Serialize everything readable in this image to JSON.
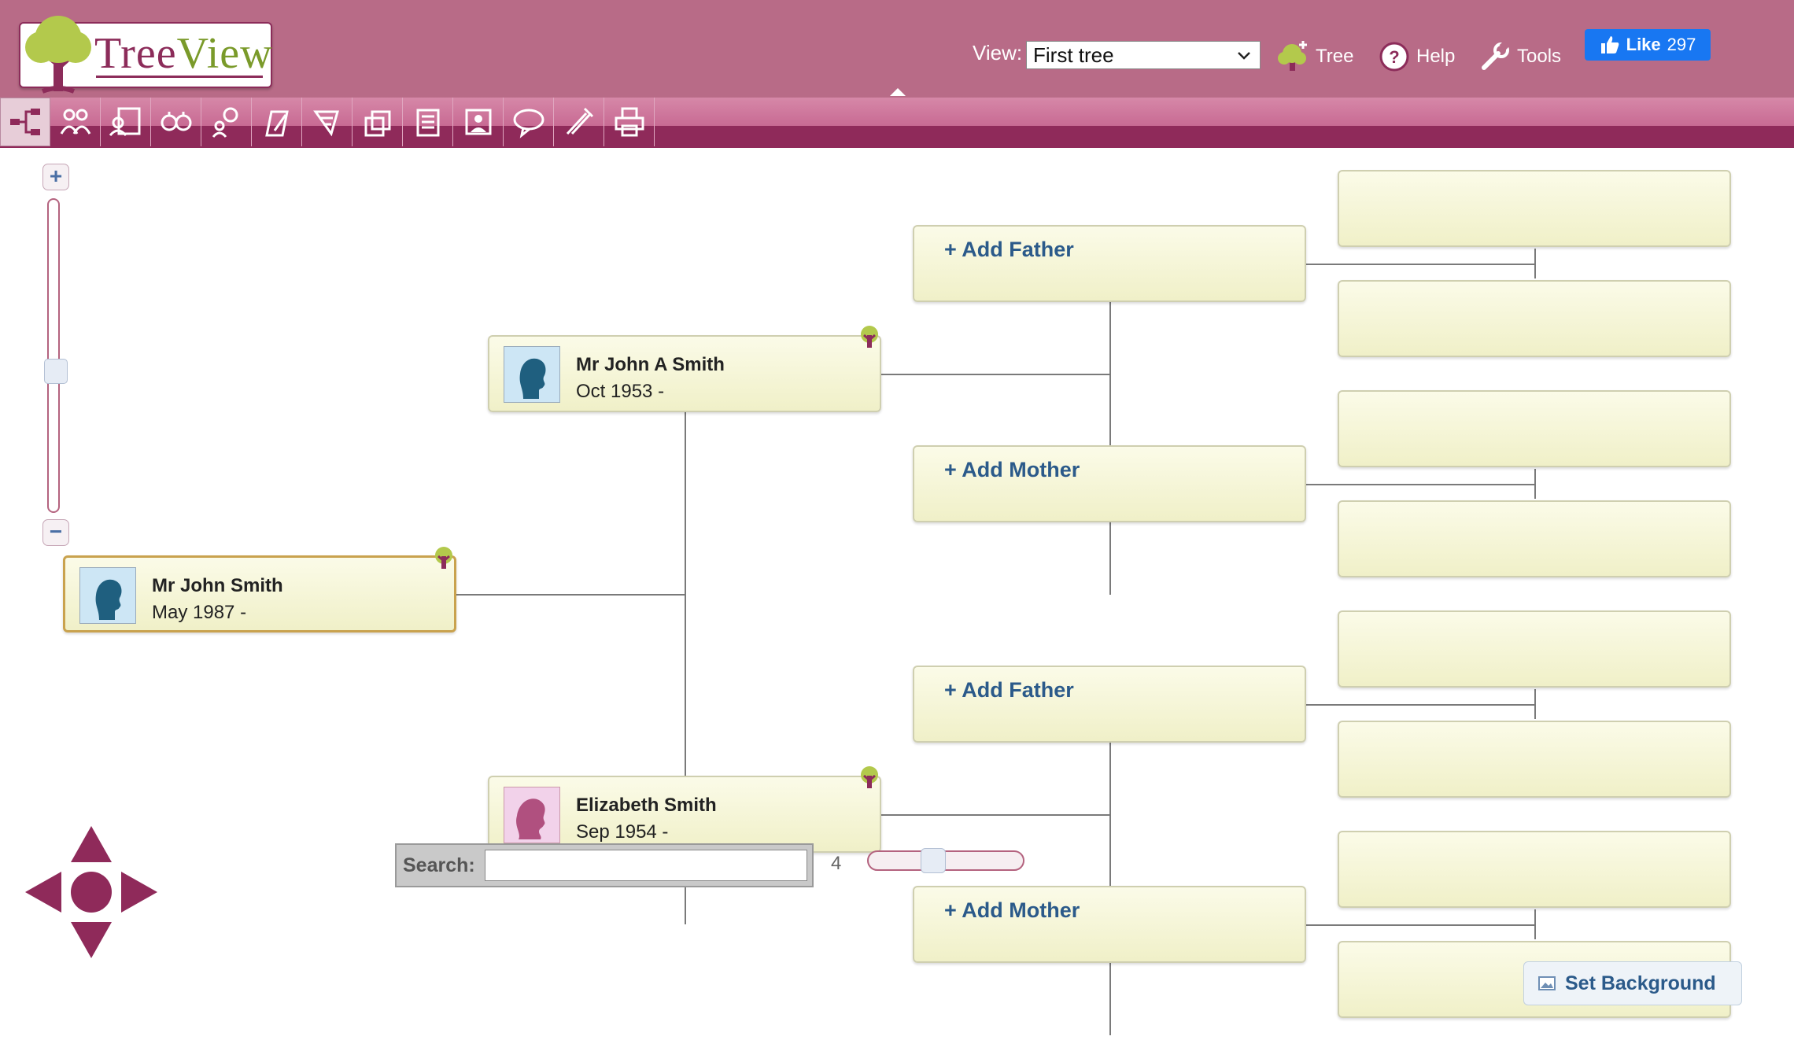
{
  "header": {
    "logo_text_a": "Tree",
    "logo_text_b": "View",
    "view_label": "View:",
    "view_selected": "First tree",
    "links": {
      "tree": "Tree",
      "help": "Help",
      "tools": "Tools"
    },
    "like_label": "Like",
    "like_count": "297"
  },
  "toolbar": {
    "buttons": [
      {
        "icon": "tree-chart-icon"
      },
      {
        "icon": "family-icon"
      },
      {
        "icon": "person-list-icon"
      },
      {
        "icon": "places-icon"
      },
      {
        "icon": "search-person-icon"
      },
      {
        "icon": "edit-icon"
      },
      {
        "icon": "sources-icon"
      },
      {
        "icon": "files-icon"
      },
      {
        "icon": "notes-icon"
      },
      {
        "icon": "profile-icon"
      },
      {
        "icon": "message-icon"
      },
      {
        "icon": "tools-icon"
      },
      {
        "icon": "print-icon"
      }
    ]
  },
  "people": {
    "root": {
      "name": "Mr John Smith",
      "date": "May 1987 -"
    },
    "father": {
      "name": "Mr John A Smith",
      "date": "Oct 1953 -"
    },
    "mother": {
      "name": "Elizabeth Smith",
      "date": "Sep 1954 -"
    }
  },
  "add": {
    "father_1": "+ Add Father",
    "mother_1": "+ Add Mother",
    "father_2": "+ Add Father",
    "mother_2": "+ Add Mother"
  },
  "controls": {
    "zoom_plus": "+",
    "zoom_minus": "−",
    "search_label": "Search:",
    "search_value": "",
    "generations": "4",
    "set_background": "Set Background"
  },
  "colors": {
    "header_bg": "#b86b87",
    "toolbar_dark": "#8f2a5a",
    "accent_link": "#2b5a8a",
    "card_bg": "#f0f0c8"
  }
}
